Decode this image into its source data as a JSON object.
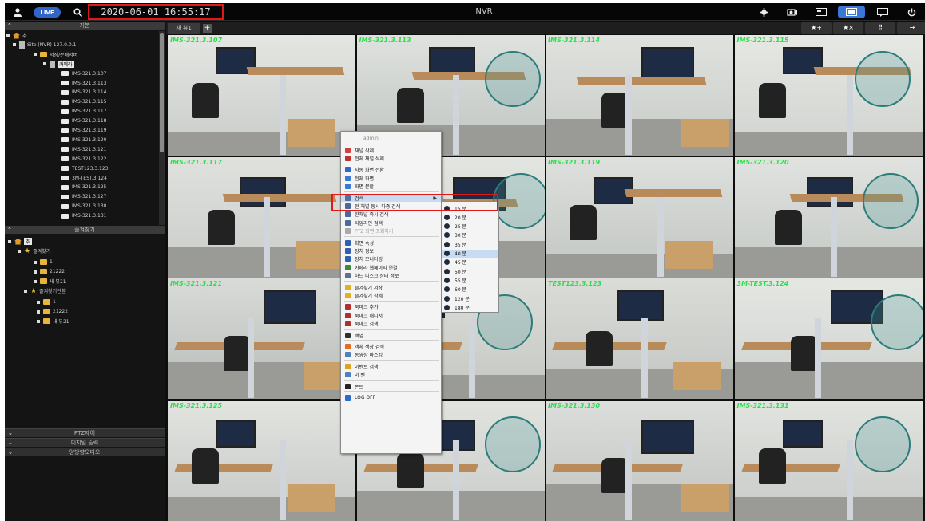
{
  "topbar": {
    "live_label": "LIVE",
    "datetime": "2020-06-01 16:55:17",
    "title": "NVR"
  },
  "left_panel": {
    "device_tree_header": "기본",
    "device_tree": [
      {
        "label": "추",
        "type": "home"
      },
      {
        "label": "Site (NVR) 127.0.0.1",
        "type": "server"
      },
      {
        "label": "저장/분배서버",
        "type": "folder"
      },
      {
        "label": "카메라",
        "type": "group"
      },
      {
        "label": "IMS-321.3.107",
        "type": "camera"
      },
      {
        "label": "IMS-321.3.113",
        "type": "camera"
      },
      {
        "label": "IMS-321.3.114",
        "type": "camera"
      },
      {
        "label": "IMS-321.3.115",
        "type": "camera"
      },
      {
        "label": "IMS-321.3.117",
        "type": "camera"
      },
      {
        "label": "IMS-321.3.118",
        "type": "camera"
      },
      {
        "label": "IMS-321.3.119",
        "type": "camera"
      },
      {
        "label": "IMS-321.3.120",
        "type": "camera"
      },
      {
        "label": "IMS-321.3.121",
        "type": "camera"
      },
      {
        "label": "IMS-321.3.122",
        "type": "camera"
      },
      {
        "label": "TEST123.3.123",
        "type": "camera"
      },
      {
        "label": "3M-TEST.3.124",
        "type": "camera"
      },
      {
        "label": "IMS-321.3.125",
        "type": "camera"
      },
      {
        "label": "IMS-321.3.127",
        "type": "camera"
      },
      {
        "label": "IMS-321.3.130",
        "type": "camera"
      },
      {
        "label": "IMS-321.3.131",
        "type": "camera"
      }
    ],
    "favorites_header": "즐겨찾기",
    "favorites_tree": [
      {
        "label": "추",
        "type": "home"
      },
      {
        "label": "즐겨찾기",
        "type": "star"
      },
      {
        "label": "1",
        "type": "folder"
      },
      {
        "label": "21222",
        "type": "folder"
      },
      {
        "label": "새 뷰21",
        "type": "folder"
      },
      {
        "label": "즐겨찾기전환",
        "type": "star"
      },
      {
        "label": "1",
        "type": "folder"
      },
      {
        "label": "21222",
        "type": "folder"
      },
      {
        "label": "새 뷰21",
        "type": "folder"
      }
    ],
    "bottom_panels": [
      "PTZ제어",
      "디지털 출력",
      "양방향오디오"
    ]
  },
  "view_tabs": {
    "tab_label": "새 뷰1",
    "add_label": "+",
    "right_buttons": [
      "★+",
      "★×",
      "⠿",
      "→"
    ]
  },
  "cameras": [
    "IMS-321.3.107",
    "IMS-321.3.113",
    "IMS-321.3.114",
    "IMS-321.3.115",
    "IMS-321.3.117",
    "",
    "IMS-321.3.119",
    "IMS-321.3.120",
    "IMS-321.3.121",
    "",
    "TEST123.3.123",
    "3M-TEST.3.124",
    "IMS-321.3.125",
    "",
    "IMS-321.3.130",
    "IMS-321.3.131"
  ],
  "context_menu": {
    "header": "admin",
    "items": [
      {
        "label": "채널 삭제",
        "color": "#d04040"
      },
      {
        "label": "전체 채널 삭제",
        "color": "#c03030"
      },
      {
        "label": "자동 화면 전환",
        "color": "#2d6ad0"
      },
      {
        "label": "전체 화면",
        "color": "#3b79d8"
      },
      {
        "label": "화면 분할",
        "color": "#3b79d8"
      },
      {
        "label": "검색",
        "color": "#5070a0",
        "submenu": true
      },
      {
        "label": "전 채널 동시 다중 검색",
        "color": "#4a6a9a"
      },
      {
        "label": "한채널 즉시 검색",
        "color": "#4a6a9a"
      },
      {
        "label": "타임라인 검색",
        "color": "#4a6a9a"
      },
      {
        "label": "PTZ 화면 조회하기",
        "color": "#aaaaaa",
        "disabled": true
      },
      {
        "label": "화면 속성",
        "color": "#3060b0"
      },
      {
        "label": "장치 정보",
        "color": "#3060b0"
      },
      {
        "label": "장치 모니터링",
        "color": "#3060b0"
      },
      {
        "label": "카메라 웹페이지 연결",
        "color": "#3a8a3a"
      },
      {
        "label": "하드 디스크 상태 정보",
        "color": "#607090"
      },
      {
        "label": "즐겨찾기 저장",
        "color": "#e0b020"
      },
      {
        "label": "즐겨찾기 삭제",
        "color": "#e0b020"
      },
      {
        "label": "북마크 추가",
        "color": "#b03030"
      },
      {
        "label": "북마크 매니저",
        "color": "#b03030"
      },
      {
        "label": "북마크 검색",
        "color": "#b03030"
      },
      {
        "label": "백업",
        "color": "#303030"
      },
      {
        "label": "객체 색상 검색",
        "color": "#e07020"
      },
      {
        "label": "동영상 마스킹",
        "color": "#5080c0"
      },
      {
        "label": "이벤트 검색",
        "color": "#e0a020"
      },
      {
        "label": "이 벤",
        "color": "#5080c0"
      },
      {
        "label": "폰트",
        "color": "#222222"
      },
      {
        "label": "LOG OFF",
        "color": "#2d6ad0"
      }
    ],
    "search_submenu": [
      "15 분",
      "20 분",
      "25 분",
      "30 분",
      "35 분",
      "40 분",
      "45 분",
      "50 분",
      "55 분",
      "60 분",
      "120 분",
      "180 분"
    ]
  }
}
